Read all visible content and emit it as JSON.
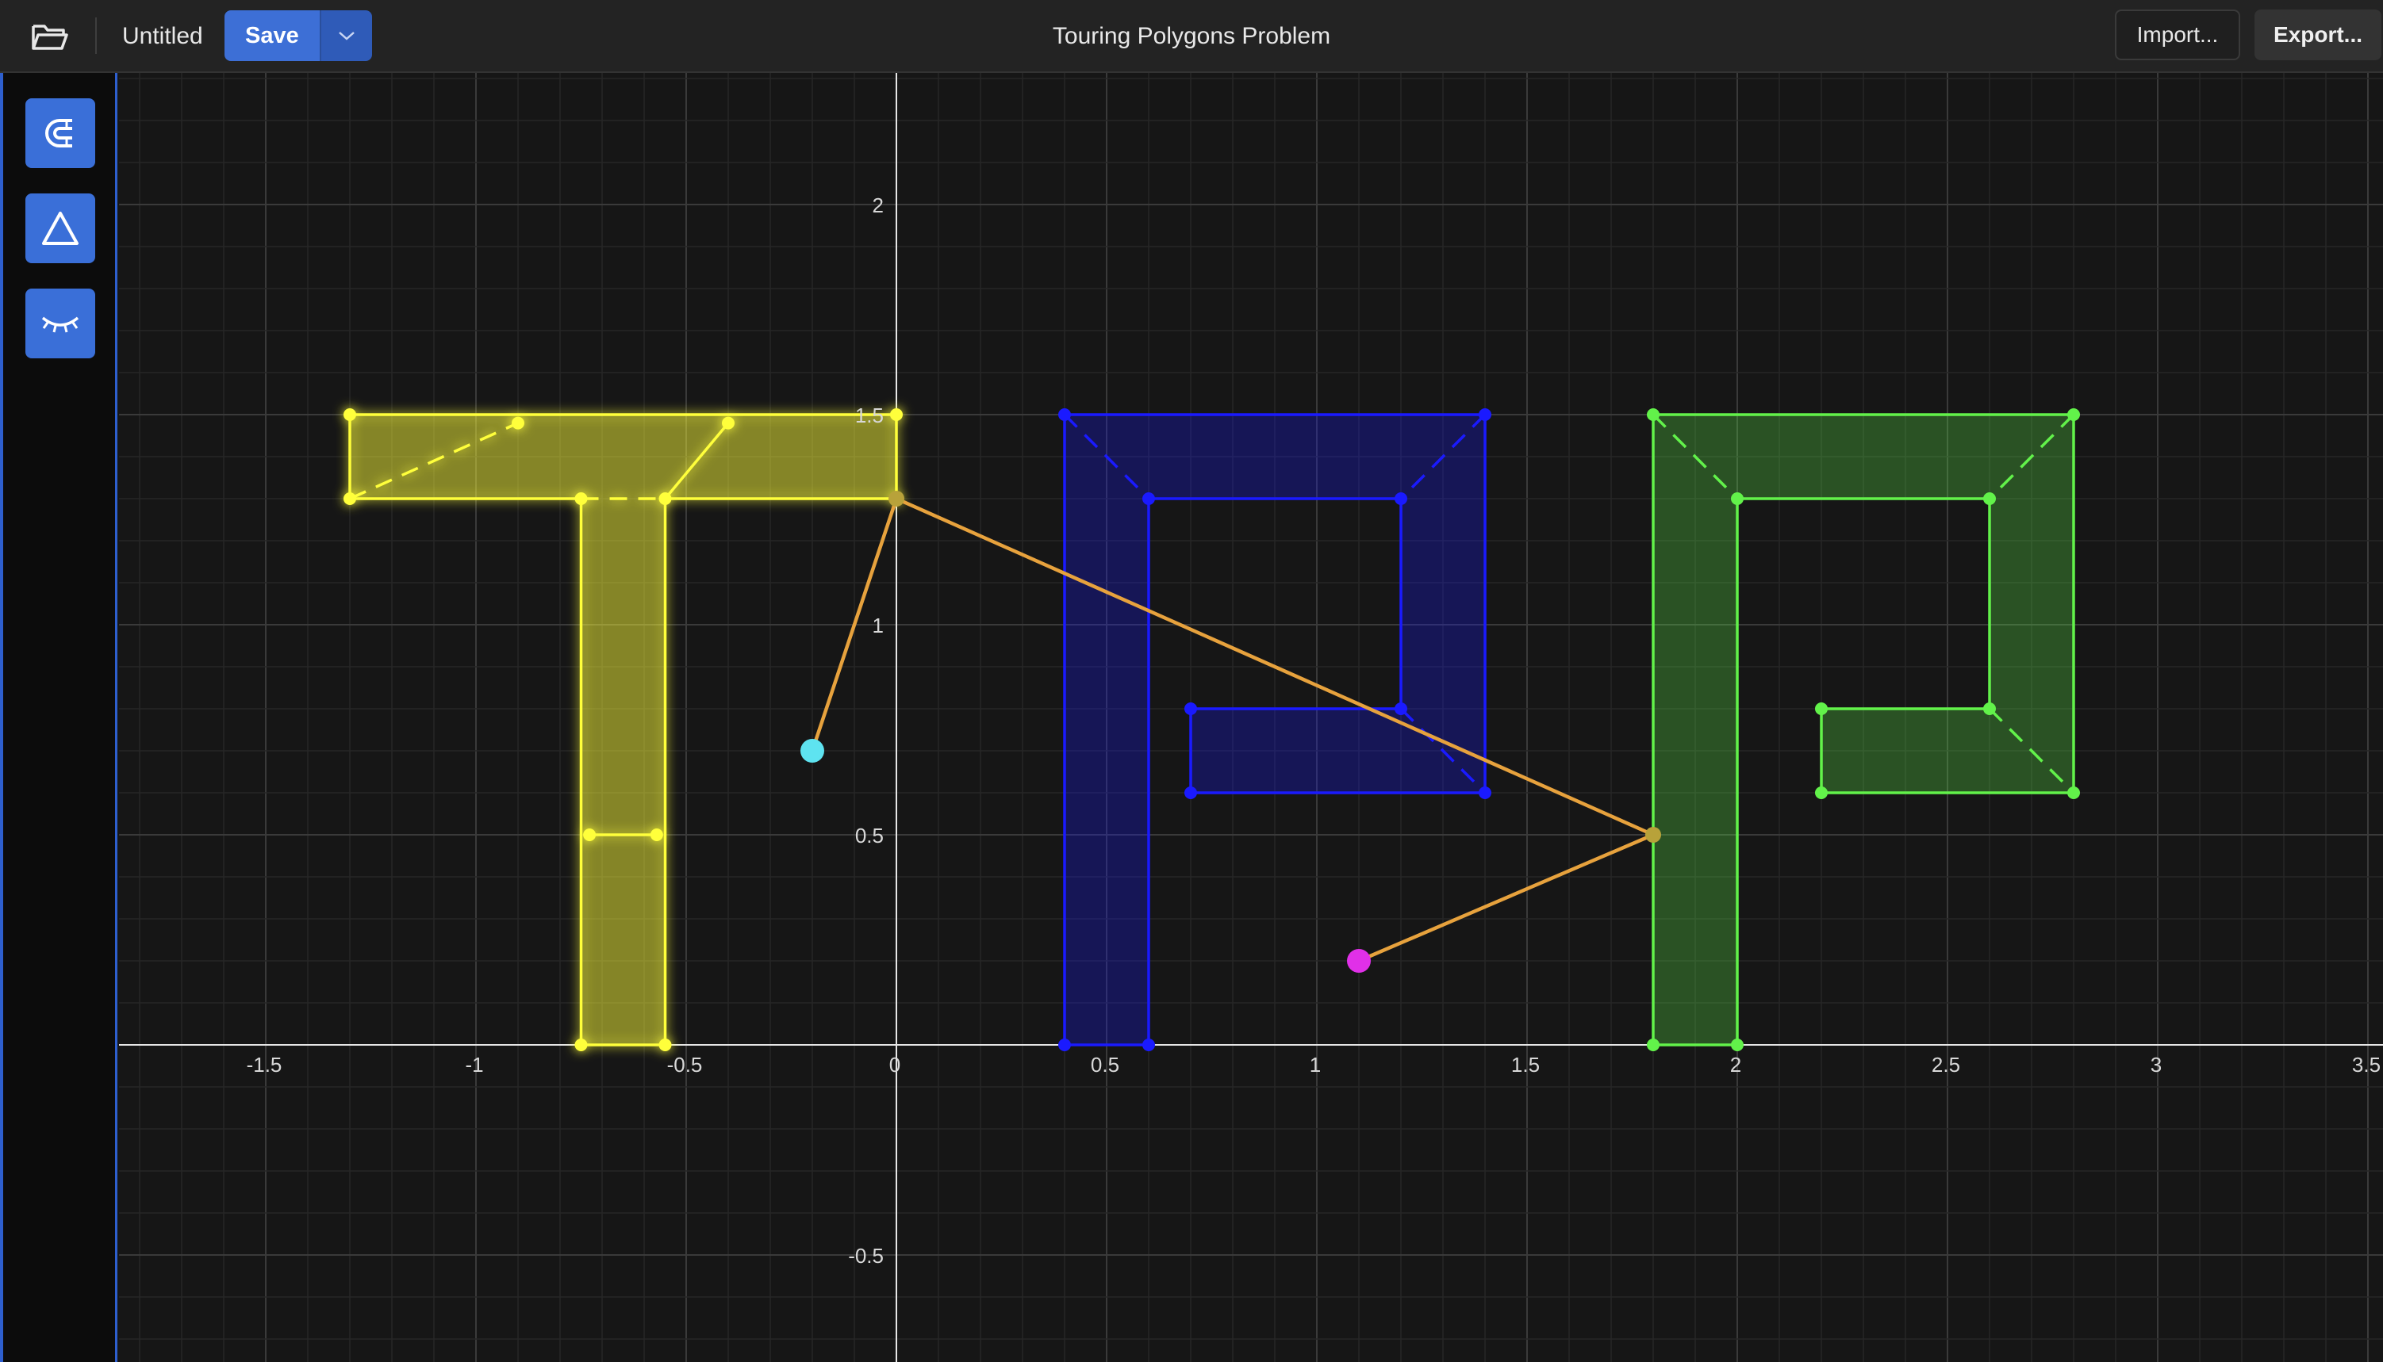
{
  "app": {
    "document_name": "Untitled",
    "save_label": "Save",
    "title": "Touring Polygons Problem",
    "import_label": "Import...",
    "export_label": "Export..."
  },
  "icons": {
    "open": "folder-open-icon",
    "save_menu": "chevron-down-icon",
    "snap": "magnet-icon",
    "polygon": "triangle-icon",
    "visibility": "eye-closed-icon"
  },
  "colors": {
    "accent": "#3d6fd6",
    "yellow": "#ffff3a",
    "blue": "#1a1aff",
    "green": "#62f24a",
    "path": "#e7a23d",
    "start": "#5ee3f0",
    "end": "#e030e8"
  },
  "plot": {
    "x_ticks": [
      -1.5,
      -1,
      -0.5,
      0,
      0.5,
      1,
      1.5,
      2,
      2.5,
      3,
      3.5
    ],
    "x_tick_labels": [
      "-1.5",
      "-1",
      "-0.5",
      "0",
      "0.5",
      "1",
      "1.5",
      "2",
      "2.5",
      "3",
      "3.5"
    ],
    "y_ticks": [
      2,
      1.5,
      1,
      0.5,
      -0.5
    ],
    "y_tick_labels": [
      "2",
      "1.5",
      "1",
      "0.5",
      "-0.5"
    ],
    "start_point": [
      -0.2,
      0.7
    ],
    "end_point": [
      1.1,
      0.2
    ],
    "path": [
      [
        -0.2,
        0.7
      ],
      [
        0,
        1.3
      ],
      [
        1.8,
        0.5
      ],
      [
        1.1,
        0.2
      ]
    ],
    "polygons": [
      {
        "id": "T",
        "color": "#ffff3a",
        "glow": true,
        "outline": [
          [
            -1.3,
            1.5
          ],
          [
            0,
            1.5
          ],
          [
            0,
            1.3
          ],
          [
            -0.55,
            1.3
          ],
          [
            -0.55,
            0.5
          ],
          [
            -0.55,
            0
          ],
          [
            -0.75,
            0
          ],
          [
            -0.75,
            0.5
          ],
          [
            -0.75,
            1.3
          ],
          [
            -1.3,
            1.3
          ]
        ],
        "edges": [
          [
            -0.73,
            0.5
          ],
          [
            -0.57,
            0.5
          ]
        ],
        "dashed": [
          [
            [
              -1.3,
              1.3
            ],
            [
              -0.9,
              1.48
            ]
          ],
          [
            [
              -0.75,
              1.3
            ],
            [
              -0.55,
              1.3
            ]
          ]
        ],
        "solid_inner": [
          [
            [
              -0.55,
              1.3
            ],
            [
              -0.4,
              1.48
            ]
          ]
        ],
        "vertices": [
          [
            -1.3,
            1.5
          ],
          [
            -0.9,
            1.48
          ],
          [
            -0.4,
            1.48
          ],
          [
            0,
            1.5
          ],
          [
            0,
            1.3
          ],
          [
            -0.55,
            1.3
          ],
          [
            -0.75,
            1.3
          ],
          [
            -1.3,
            1.3
          ],
          [
            -0.73,
            0.5
          ],
          [
            -0.57,
            0.5
          ],
          [
            -0.75,
            0
          ],
          [
            -0.55,
            0
          ]
        ]
      },
      {
        "id": "P1",
        "color": "#1a1aff",
        "glow": false,
        "outline": [
          [
            0.4,
            0
          ],
          [
            0.4,
            1.5
          ],
          [
            1.4,
            1.5
          ],
          [
            1.4,
            0.6
          ],
          [
            0.7,
            0.6
          ],
          [
            0.7,
            0.8
          ],
          [
            1.2,
            0.8
          ],
          [
            1.2,
            1.3
          ],
          [
            0.6,
            1.3
          ],
          [
            0.6,
            0
          ]
        ],
        "dashed": [
          [
            [
              0.4,
              1.5
            ],
            [
              0.6,
              1.3
            ]
          ],
          [
            [
              1.4,
              1.5
            ],
            [
              1.2,
              1.3
            ]
          ],
          [
            [
              1.2,
              0.8
            ],
            [
              1.4,
              0.6
            ]
          ]
        ],
        "solid_inner": [],
        "vertices": [
          [
            0.4,
            1.5
          ],
          [
            1.4,
            1.5
          ],
          [
            0.6,
            1.3
          ],
          [
            1.2,
            1.3
          ],
          [
            0.7,
            0.8
          ],
          [
            1.2,
            0.8
          ],
          [
            0.7,
            0.6
          ],
          [
            1.4,
            0.6
          ],
          [
            0.4,
            0
          ],
          [
            0.6,
            0
          ]
        ]
      },
      {
        "id": "P2",
        "color": "#62f24a",
        "glow": false,
        "outline": [
          [
            1.8,
            0
          ],
          [
            1.8,
            1.5
          ],
          [
            2.8,
            1.5
          ],
          [
            2.8,
            0.6
          ],
          [
            2.2,
            0.6
          ],
          [
            2.2,
            0.8
          ],
          [
            2.6,
            0.8
          ],
          [
            2.6,
            1.3
          ],
          [
            2,
            1.3
          ],
          [
            2,
            0
          ]
        ],
        "dashed": [
          [
            [
              1.8,
              1.5
            ],
            [
              2,
              1.3
            ]
          ],
          [
            [
              2.8,
              1.5
            ],
            [
              2.6,
              1.3
            ]
          ],
          [
            [
              2.6,
              0.8
            ],
            [
              2.8,
              0.6
            ]
          ]
        ],
        "solid_inner": [],
        "vertices": [
          [
            1.8,
            1.5
          ],
          [
            2.8,
            1.5
          ],
          [
            2,
            1.3
          ],
          [
            2.6,
            1.3
          ],
          [
            2.2,
            0.8
          ],
          [
            2.6,
            0.8
          ],
          [
            2.2,
            0.6
          ],
          [
            2.8,
            0.6
          ],
          [
            1.8,
            0.5
          ],
          [
            1.8,
            0
          ],
          [
            2,
            0
          ]
        ]
      }
    ]
  }
}
